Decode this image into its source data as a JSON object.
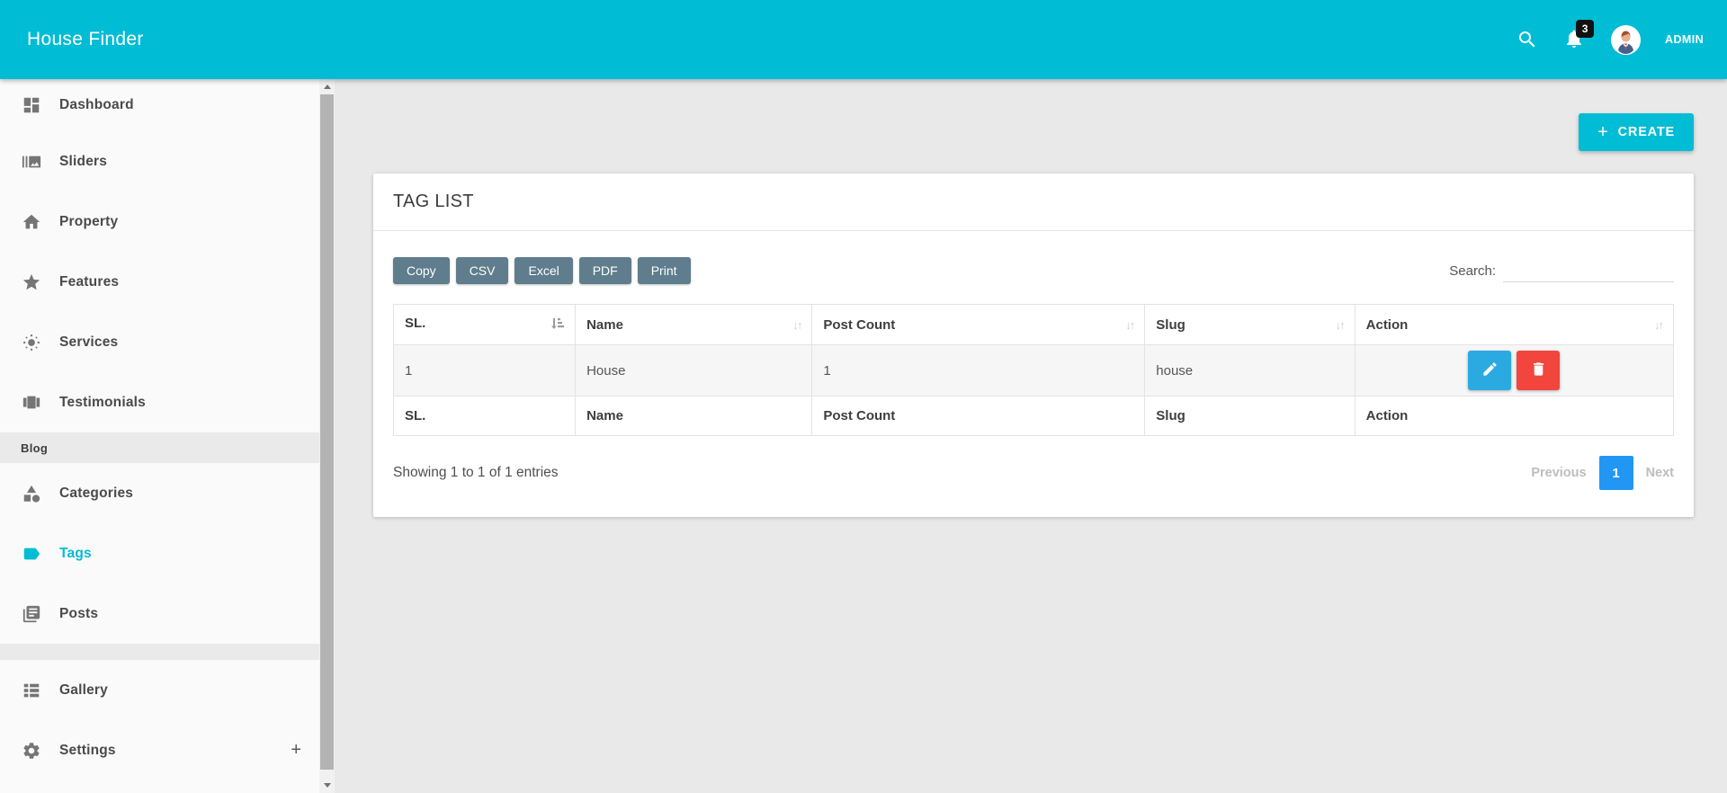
{
  "colors": {
    "topbar": "#00bcd4",
    "accent": "#00bcd4",
    "sidebar_active": "#00bcd4",
    "export_button": "#5f7d8c",
    "edit_button": "#2baae2",
    "delete_button": "#f2453d",
    "active_page": "#2196f3",
    "badge": "#111111"
  },
  "header": {
    "brand": "House Finder",
    "notification_count": "3",
    "admin_label": "ADMIN"
  },
  "sidebar": {
    "items": [
      {
        "label": "Dashboard",
        "icon": "dashboard-icon"
      },
      {
        "label": "Sliders",
        "icon": "sliders-icon"
      },
      {
        "label": "Property",
        "icon": "home-icon"
      },
      {
        "label": "Features",
        "icon": "star-icon"
      },
      {
        "label": "Services",
        "icon": "brightness-icon"
      },
      {
        "label": "Testimonials",
        "icon": "carousel-icon"
      }
    ],
    "blog_section_label": "Blog",
    "blog_items": [
      {
        "label": "Categories",
        "icon": "category-icon"
      },
      {
        "label": "Tags",
        "icon": "tag-icon",
        "active": true
      },
      {
        "label": "Posts",
        "icon": "posts-icon"
      }
    ],
    "bottom_items": [
      {
        "label": "Gallery",
        "icon": "gallery-icon"
      },
      {
        "label": "Settings",
        "icon": "gear-icon",
        "expand_glyph": "+"
      }
    ]
  },
  "main": {
    "create_button": {
      "plus": "+",
      "label": "CREATE"
    },
    "card": {
      "title": "TAG LIST",
      "export_buttons": [
        "Copy",
        "CSV",
        "Excel",
        "PDF",
        "Print"
      ],
      "search_label": "Search:",
      "table": {
        "columns": [
          "SL.",
          "Name",
          "Post Count",
          "Slug",
          "Action"
        ],
        "rows": [
          {
            "sl": "1",
            "name": "House",
            "post_count": "1",
            "slug": "house"
          }
        ]
      },
      "info": "Showing 1 to 1 of 1 entries",
      "pagination": {
        "previous": "Previous",
        "page": "1",
        "next": "Next"
      }
    }
  }
}
